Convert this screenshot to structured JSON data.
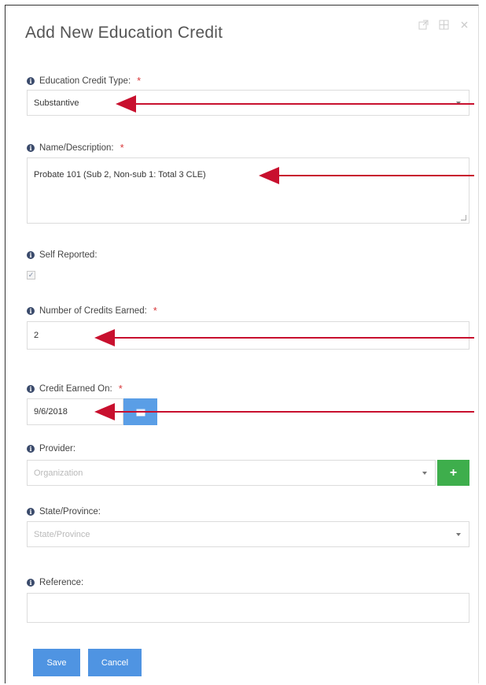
{
  "dialog": {
    "title": "Add New Education Credit"
  },
  "fields": {
    "credit_type": {
      "label": "Education Credit Type:",
      "value": "Substantive"
    },
    "name": {
      "label": "Name/Description:",
      "value": "Probate 101 (Sub 2, Non-sub 1: Total 3 CLE)"
    },
    "self_reported": {
      "label": "Self Reported:",
      "checked": true
    },
    "credits": {
      "label": "Number of Credits Earned:",
      "value": "2"
    },
    "earned_on": {
      "label": "Credit Earned On:",
      "value": "9/6/2018"
    },
    "provider": {
      "label": "Provider:",
      "placeholder": "Organization"
    },
    "state": {
      "label": "State/Province:",
      "placeholder": "State/Province"
    },
    "reference": {
      "label": "Reference:",
      "value": ""
    }
  },
  "buttons": {
    "save": "Save",
    "cancel": "Cancel"
  },
  "icons": [
    "external-link-icon",
    "grid-icon",
    "close-icon",
    "info-icon",
    "calendar-icon",
    "plus-icon",
    "chevron-down-icon",
    "check-icon",
    "arrow-annotation"
  ],
  "colors": {
    "required": "#d9383a",
    "primary": "#4f94e2",
    "success": "#3eae4c",
    "annotation": "#c8102e"
  }
}
